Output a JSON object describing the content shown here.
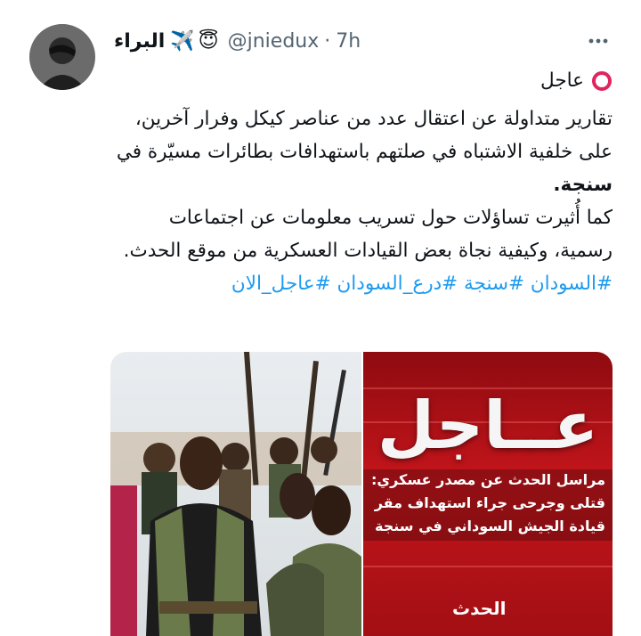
{
  "tweet": {
    "author": {
      "display_name": "البراء",
      "emojis": [
        "😇",
        "✈️"
      ],
      "handle": "@jniedux",
      "separator": "·",
      "time": "7h"
    },
    "badge_label": "عاجل",
    "paragraphs": [
      {
        "plain": "تقارير متداولة عن اعتقال عدد من عناصر كيكل وفرار آخرين، على خلفية الاشتباه في صلتهم باستهدافات بطائرات مسيّرة في ",
        "bold": "سنجة",
        "end": "."
      },
      {
        "plain": "كما أُثيرت تساؤلات حول تسريب معلومات عن اجتماعات رسمية، وكيفية نجاة بعض القيادات العسكرية من موقع الحدث."
      }
    ],
    "hashtags": [
      "#السودان",
      "#سنجة",
      "#درع_السودان",
      "#عاجل_الان"
    ],
    "media": {
      "news_graphic": {
        "title": "عــاجل",
        "lines": [
          "مراسل الحدث عن مصدر عسكري:",
          "قتلى وجرحى جراء استهداف مقر",
          "قيادة الجيش السوداني في سنجة"
        ],
        "logo": "الحدث"
      }
    },
    "colors": {
      "hashtag": "#1d9bf0",
      "badge_ring": "#e0245e",
      "banner_red": "#c3151b"
    },
    "icons": {
      "more": "more-horizontal-icon",
      "badge": "red-circle-icon"
    }
  }
}
